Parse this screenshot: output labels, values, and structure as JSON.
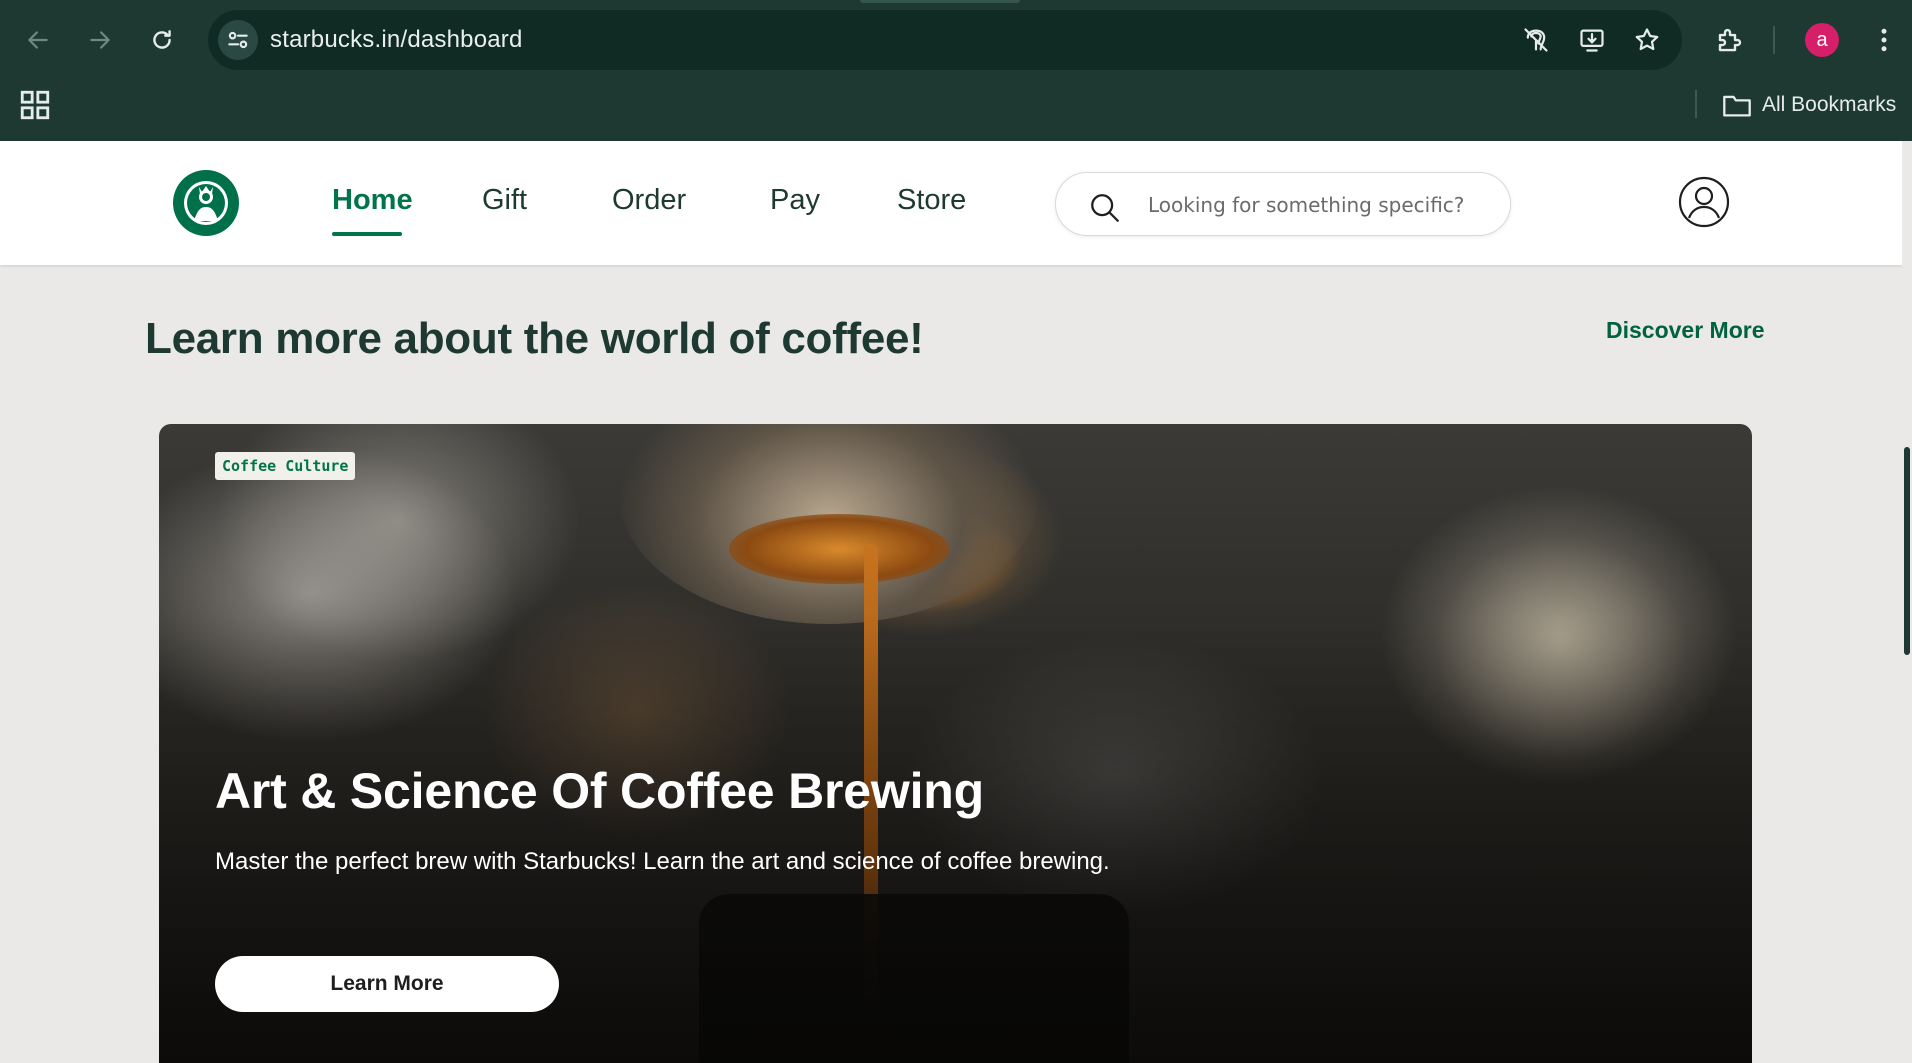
{
  "browser": {
    "url": "starbucks.in/dashboard",
    "avatar_letter": "a",
    "bookmarks_label": "All Bookmarks",
    "icons": [
      "back-icon",
      "forward-icon",
      "reload-icon",
      "site-info-icon",
      "tracking-off-icon",
      "install-app-icon",
      "bookmark-star-icon",
      "extensions-icon",
      "menu-icon",
      "apps-grid-icon",
      "folder-icon"
    ]
  },
  "header": {
    "nav": [
      {
        "label": "Home",
        "active": true
      },
      {
        "label": "Gift"
      },
      {
        "label": "Order"
      },
      {
        "label": "Pay"
      },
      {
        "label": "Store"
      }
    ],
    "search_placeholder": "Looking for something specific?"
  },
  "main": {
    "section_title": "Learn more about the world of coffee!",
    "discover_label": "Discover More",
    "hero": {
      "tag": "Coffee Culture",
      "title": "Art & Science Of Coffee Brewing",
      "description": "Master the perfect brew with Starbucks! Learn the art and science of coffee brewing.",
      "button_label": "Learn More"
    }
  },
  "colors": {
    "brand_dark": "#1e3932",
    "brand_green": "#00754a",
    "page_bg": "#ebe9e7",
    "avatar": "#d61f69"
  }
}
